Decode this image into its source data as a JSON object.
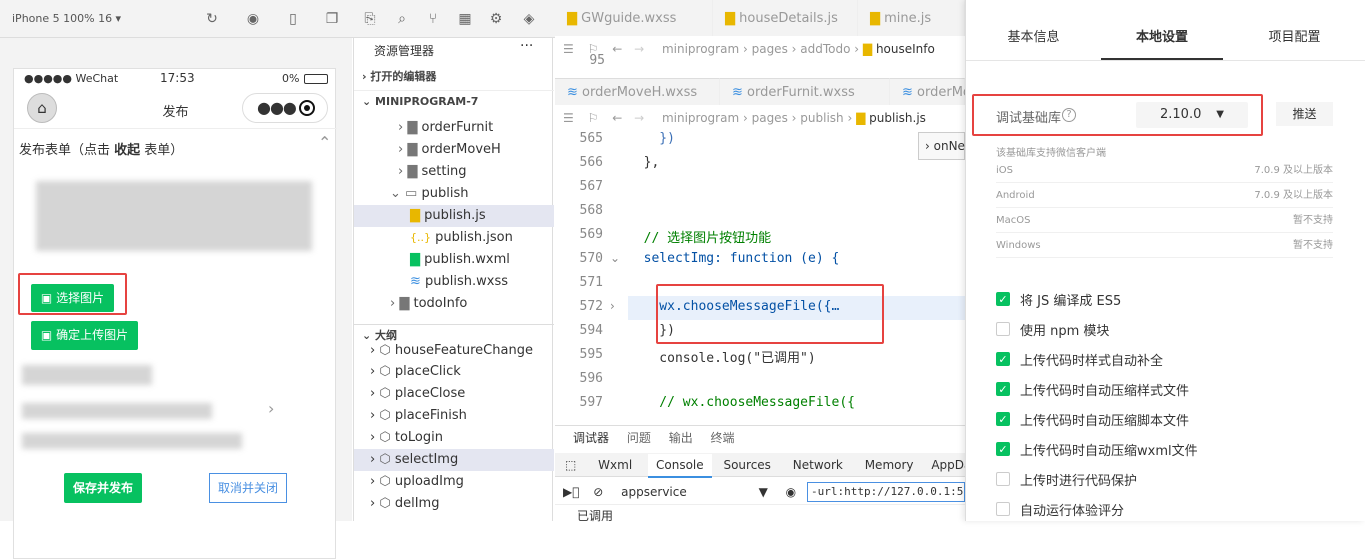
{
  "top_bar": {
    "device": "iPhone 5 100% 16 ▾"
  },
  "phone": {
    "carrier": "●●●●● WeChat",
    "time": "17:53",
    "battery": "0%",
    "title": "发布",
    "form_header_a": "发布表单（点击 ",
    "form_header_b": "收起",
    "form_header_c": " 表单）",
    "choose_image": "选择图片",
    "confirm_upload": "确定上传图片",
    "save_publish": "保存并发布",
    "cancel_close": "取消并关闭"
  },
  "explorer": {
    "title": "资源管理器",
    "open_editors": "打开的编辑器",
    "project": "MINIPROGRAM-7",
    "files": [
      "orderFurnit",
      "orderMoveH",
      "setting",
      "publish",
      "publish.js",
      "publish.json",
      "publish.wxml",
      "publish.wxss",
      "todoInfo"
    ],
    "outline_title": "大纲",
    "outline": [
      "houseFeatureChange",
      "placeClick",
      "placeClose",
      "placeFinish",
      "toLogin",
      "selectImg",
      "uploadImg",
      "delImg"
    ]
  },
  "editor": {
    "tabs": [
      "GWguide.wxss",
      "houseDetails.js",
      "mine.js"
    ],
    "tabs2": [
      "orderMoveH.wxss",
      "orderFurnit.wxss",
      "orderMo"
    ],
    "crumb1": [
      "miniprogram",
      "pages",
      "addTodo",
      "houseInfo"
    ],
    "crumb2": [
      "miniprogram",
      "pages",
      "publish",
      "publish.js"
    ],
    "peek_first_line": "95",
    "float_hint": "onNe",
    "lines": [
      {
        "n": "565",
        "t": "    })"
      },
      {
        "n": "566",
        "t": "  },"
      },
      {
        "n": "567",
        "t": ""
      },
      {
        "n": "568",
        "t": ""
      },
      {
        "n": "569",
        "t": "  // 选择图片按钮功能"
      },
      {
        "n": "570",
        "t": "  selectImg: function (e) {"
      },
      {
        "n": "571",
        "t": ""
      },
      {
        "n": "572",
        "t": "    wx.chooseMessageFile({…"
      },
      {
        "n": "594",
        "t": "    })"
      },
      {
        "n": "595",
        "t": "    console.log(\"已调用\")"
      },
      {
        "n": "596",
        "t": ""
      },
      {
        "n": "597",
        "t": "    // wx.chooseMessageFile({"
      }
    ]
  },
  "console": {
    "tabs": [
      "调试器",
      "问题",
      "输出",
      "终端"
    ],
    "devtabs": [
      "Wxml",
      "Console",
      "Sources",
      "Network",
      "Memory",
      "AppDa"
    ],
    "context": "appservice",
    "url": "-url:http://127.0.0.1:56594/ap",
    "output": "已调用"
  },
  "settings": {
    "tabs": [
      "基本信息",
      "本地设置",
      "项目配置"
    ],
    "lib_label": "调试基础库",
    "lib_version": "2.10.0",
    "push": "推送",
    "support_note": "该基础库支持微信客户端",
    "os_rows": [
      {
        "os": "iOS",
        "v": "7.0.9 及以上版本"
      },
      {
        "os": "Android",
        "v": "7.0.9 及以上版本"
      },
      {
        "os": "MacOS",
        "v": "暂不支持"
      },
      {
        "os": "Windows",
        "v": "暂不支持"
      }
    ],
    "options": [
      {
        "label": "将 JS 编译成 ES5",
        "checked": true
      },
      {
        "label": "使用 npm 模块",
        "checked": false
      },
      {
        "label": "上传代码时样式自动补全",
        "checked": true
      },
      {
        "label": "上传代码时自动压缩样式文件",
        "checked": true
      },
      {
        "label": "上传代码时自动压缩脚本文件",
        "checked": true
      },
      {
        "label": "上传代码时自动压缩wxml文件",
        "checked": true
      },
      {
        "label": "上传时进行代码保护",
        "checked": false
      },
      {
        "label": "自动运行体验评分",
        "checked": false
      }
    ]
  },
  "colors": {
    "accent_green": "#07c160",
    "highlight_red": "#e64340",
    "keyword_blue": "#0000ff"
  }
}
